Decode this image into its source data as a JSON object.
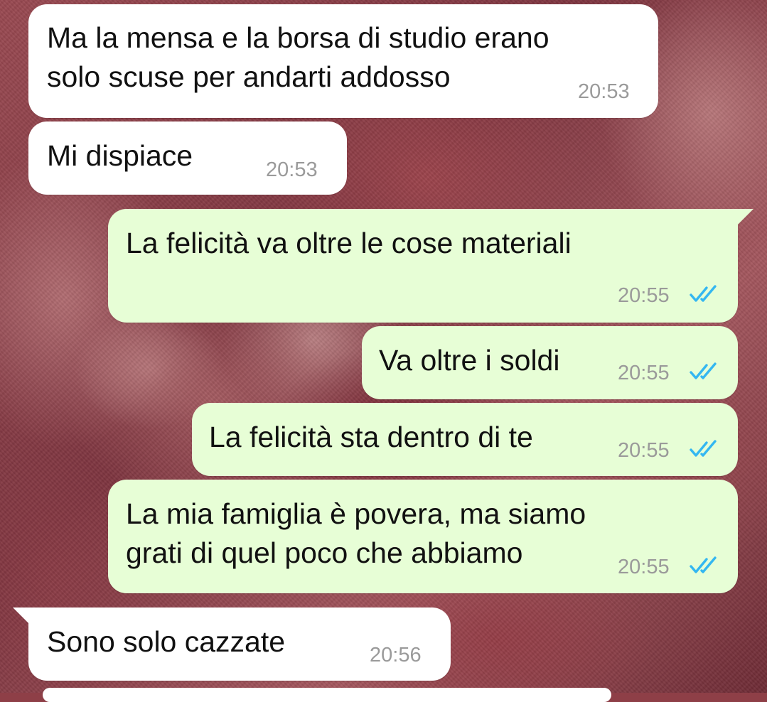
{
  "colors": {
    "incoming_bubble": "#ffffff",
    "outgoing_bubble": "#e7fed6",
    "read_ticks": "#34b7f1",
    "timestamp": "#9a9a9a"
  },
  "messages": [
    {
      "direction": "incoming",
      "text": "Ma la mensa e la borsa di studio erano\nsolo scuse per andarti addosso",
      "time": "20:53"
    },
    {
      "direction": "incoming",
      "text": "Mi dispiace",
      "time": "20:53"
    },
    {
      "direction": "outgoing",
      "text": "La felicità va oltre le cose materiali",
      "time": "20:55",
      "status_icon": "double-check-read-icon"
    },
    {
      "direction": "outgoing",
      "text": "Va oltre i soldi",
      "time": "20:55",
      "status_icon": "double-check-read-icon"
    },
    {
      "direction": "outgoing",
      "text": "La felicità sta dentro di te",
      "time": "20:55",
      "status_icon": "double-check-read-icon"
    },
    {
      "direction": "outgoing",
      "text": "La mia famiglia è povera, ma siamo\ngrati di quel poco che abbiamo",
      "time": "20:55",
      "status_icon": "double-check-read-icon"
    },
    {
      "direction": "incoming",
      "text": "Sono solo cazzate",
      "time": "20:56"
    }
  ]
}
